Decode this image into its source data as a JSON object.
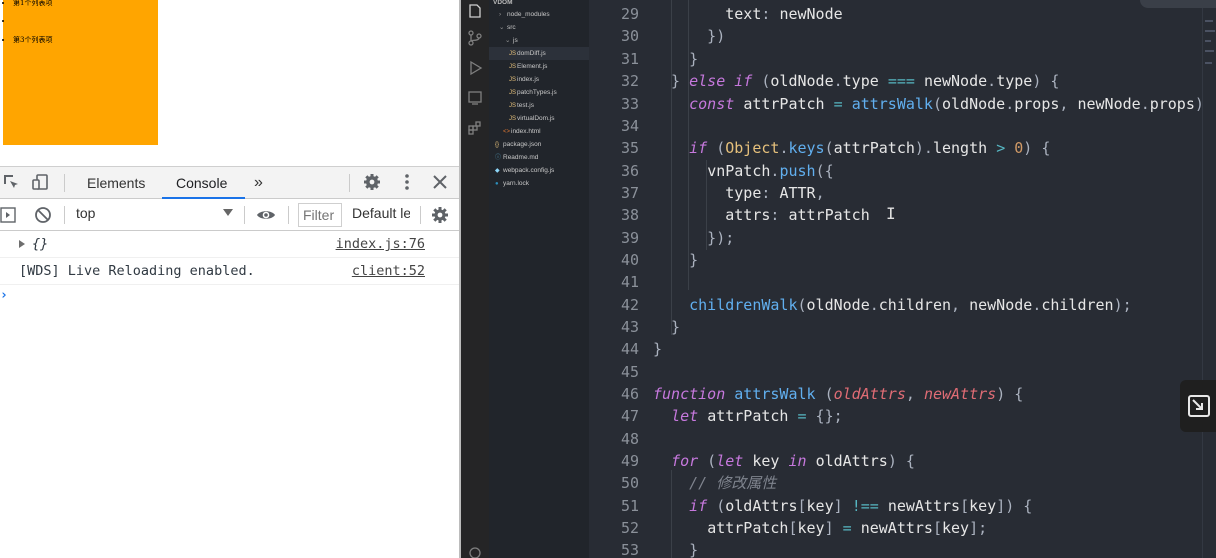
{
  "preview": {
    "list_items": [
      "第1个列表项",
      "",
      "第3个列表项"
    ]
  },
  "devtools": {
    "tabs": [
      "Elements",
      "Console"
    ],
    "more_tabs": "»",
    "context": "top",
    "filter_placeholder": "Filter",
    "levels": "Default levels",
    "console": [
      {
        "message": "{}",
        "source": "index.js:76"
      },
      {
        "message": "[WDS] Live Reloading enabled.",
        "source": "client:52"
      }
    ],
    "prompt": "›"
  },
  "explorer": {
    "root": "VDOM",
    "items": [
      {
        "label": "node_modules",
        "kind": "folder"
      },
      {
        "label": "src",
        "kind": "folder"
      },
      {
        "label": "js",
        "kind": "folder"
      },
      {
        "label": "domDiff.js",
        "kind": "js"
      },
      {
        "label": "Element.js",
        "kind": "js"
      },
      {
        "label": "index.js",
        "kind": "js"
      },
      {
        "label": "patchTypes.js",
        "kind": "js"
      },
      {
        "label": "test.js",
        "kind": "js"
      },
      {
        "label": "virtualDom.js",
        "kind": "js"
      },
      {
        "label": "index.html",
        "kind": "html"
      },
      {
        "label": "package.json",
        "kind": "json"
      },
      {
        "label": "Readme.md",
        "kind": "md"
      },
      {
        "label": "webpack.config.js",
        "kind": "js"
      },
      {
        "label": "yarn.lock",
        "kind": "lock"
      }
    ]
  },
  "editor": {
    "line_numbers": [
      "29",
      "30",
      "31",
      "32",
      "33",
      "34",
      "35",
      "36",
      "37",
      "38",
      "39",
      "40",
      "41",
      "42",
      "43",
      "44",
      "45",
      "46",
      "47",
      "48",
      "49",
      "50",
      "51",
      "52",
      "53"
    ],
    "comment_text": "// 修改属性"
  },
  "colors": {
    "orange": "#ffa500",
    "editor_bg": "#282c34",
    "accent": "#1a73e8"
  }
}
